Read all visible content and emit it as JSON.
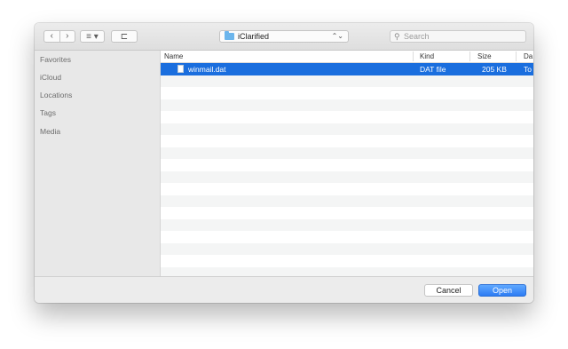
{
  "toolbar": {
    "back_glyph": "‹",
    "forward_glyph": "›",
    "view_glyph": "≡ ▾",
    "newfolder_glyph": "⊏",
    "path": "iClarified",
    "path_chevrons": "⌃⌄",
    "search_glyph": "⚲",
    "search_placeholder": "Search"
  },
  "sidebar": {
    "items": [
      {
        "label": "Favorites"
      },
      {
        "label": "iCloud"
      },
      {
        "label": "Locations"
      },
      {
        "label": "Tags"
      },
      {
        "label": "Media"
      }
    ]
  },
  "columns": {
    "name": "Name",
    "kind": "Kind",
    "size": "Size",
    "date": "Da"
  },
  "files": [
    {
      "name": "winmail.dat",
      "kind": "DAT file",
      "size": "205 KB",
      "date": "To"
    }
  ],
  "buttons": {
    "cancel": "Cancel",
    "open": "Open"
  },
  "colors": {
    "selection": "#1a6ede",
    "accent": "#2d7cf4",
    "folder": "#6bb5ec"
  },
  "icons": [
    "back-icon",
    "forward-icon",
    "view-mode-icon",
    "new-folder-icon",
    "folder-icon",
    "search-icon",
    "file-icon"
  ]
}
